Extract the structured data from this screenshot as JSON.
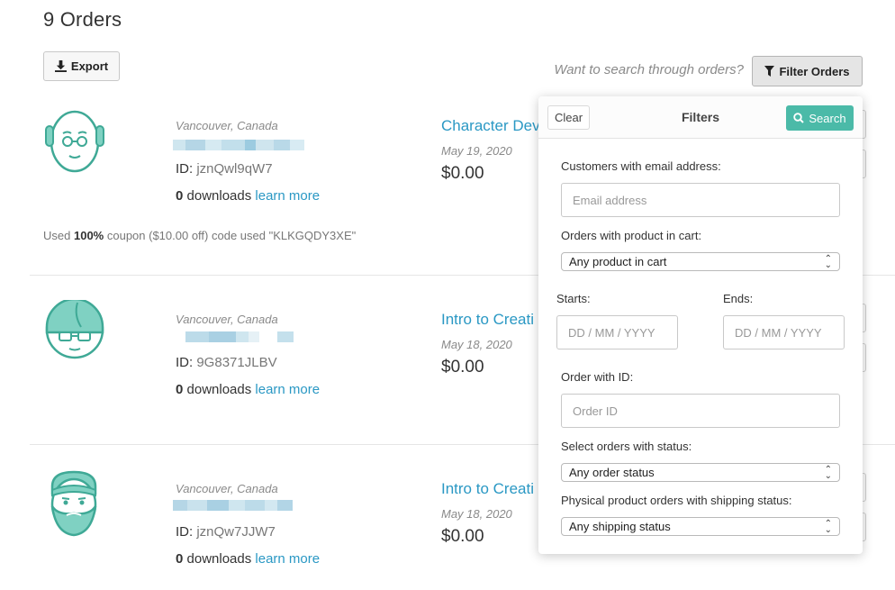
{
  "header": {
    "title": "9 Orders",
    "export_label": "Export",
    "search_hint": "Want to search through orders?",
    "filter_label": "Filter Orders"
  },
  "orders": [
    {
      "location": "Vancouver, Canada",
      "id_label": "ID:",
      "id_value": "jznQwl9qW7",
      "downloads_count": "0",
      "downloads_text": "downloads",
      "learn_more": "learn more",
      "product": "Character Dev",
      "date": "May 19, 2020",
      "price": "$0.00",
      "coupon_prefix": "Used",
      "coupon_percent": "100%",
      "coupon_suffix": "coupon ($10.00 off) code used \"KLKGQDY3XE\""
    },
    {
      "location": "Vancouver, Canada",
      "id_label": "ID:",
      "id_value": "9G8371JLBV",
      "downloads_count": "0",
      "downloads_text": "downloads",
      "learn_more": "learn more",
      "product": "Intro to Creati",
      "date": "May 18, 2020",
      "price": "$0.00"
    },
    {
      "location": "Vancouver, Canada",
      "id_label": "ID:",
      "id_value": "jznQw7JJW7",
      "downloads_count": "0",
      "downloads_text": "downloads",
      "learn_more": "learn more",
      "product": "Intro to Creati",
      "date": "May 18, 2020",
      "price": "$0.00"
    }
  ],
  "filters": {
    "clear_label": "Clear",
    "title": "Filters",
    "search_label": "Search",
    "email_label": "Customers with email address:",
    "email_placeholder": "Email address",
    "product_label": "Orders with product in cart:",
    "product_value": "Any product in cart",
    "starts_label": "Starts:",
    "starts_placeholder": "DD / MM / YYYY",
    "ends_label": "Ends:",
    "ends_placeholder": "DD / MM / YYYY",
    "order_id_label": "Order with ID:",
    "order_id_placeholder": "Order ID",
    "status_label": "Select orders with status:",
    "status_value": "Any order status",
    "shipping_label": "Physical product orders with shipping status:",
    "shipping_value": "Any shipping status"
  },
  "colors": {
    "accent": "#2a98c4",
    "avatar_teal": "#3fa996",
    "search_button": "#4bbaa8"
  }
}
